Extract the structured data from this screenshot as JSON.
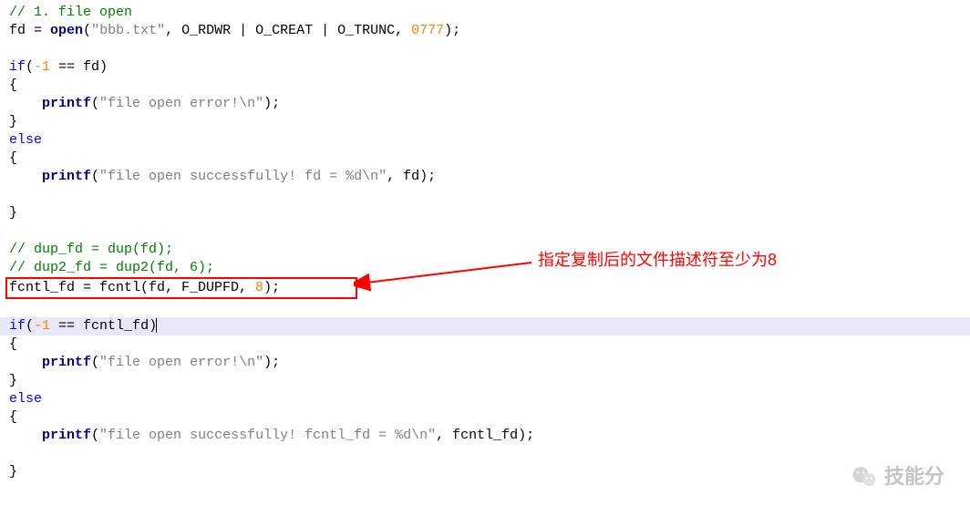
{
  "lines": {
    "l1_comment": "// 1. file open",
    "l2_ident": "fd",
    "l2_eq": " = ",
    "l2_func": "open",
    "l2_paren_open": "(",
    "l2_str": "\"bbb.txt\"",
    "l2_mid": ", O_RDWR | O_CREAT | O_TRUNC, ",
    "l2_num": "0777",
    "l2_end": ");",
    "l4_if": "if",
    "l4_cond_open": "(",
    "l4_neg1": "-1",
    "l4_cond_mid": " == fd)",
    "l5_brace": "{",
    "l6_indent": "    ",
    "l6_func": "printf",
    "l6_open": "(",
    "l6_str": "\"file open error!\\n\"",
    "l6_end": ");",
    "l7_brace": "}",
    "l8_else": "else",
    "l9_brace": "{",
    "l10_indent": "    ",
    "l10_func": "printf",
    "l10_open": "(",
    "l10_str": "\"file open successfully! fd = %d\\n\"",
    "l10_mid": ", fd);",
    "l12_brace": "}",
    "l14_comment": "// dup_fd = dup(fd);",
    "l15_comment": "// dup2_fd = dup2(fd, 6);",
    "l16_ident": "fcntl_fd = fcntl(fd, F_DUPFD, ",
    "l16_num": "8",
    "l16_end": ");",
    "l18_if": "if",
    "l18_open": "(",
    "l18_neg1": "-1",
    "l18_mid": " == fcntl_fd)",
    "l19_brace": "{",
    "l20_indent": "    ",
    "l20_func": "printf",
    "l20_open": "(",
    "l20_str": "\"file open error!\\n\"",
    "l20_end": ");",
    "l21_brace": "}",
    "l22_else": "else",
    "l23_brace": "{",
    "l24_indent": "    ",
    "l24_func": "printf",
    "l24_open": "(",
    "l24_str": "\"file open successfully! fcntl_fd = %d\\n\"",
    "l24_mid": ", fcntl_fd);",
    "l26_brace": "}"
  },
  "annotation": {
    "text": "指定复制后的文件描述符至少为8"
  },
  "watermark": {
    "text": "技能分"
  }
}
